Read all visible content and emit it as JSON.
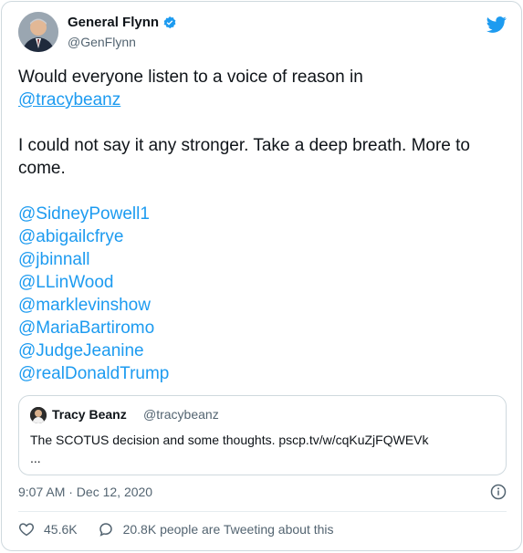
{
  "author": {
    "name": "General Flynn",
    "handle": "@GenFlynn"
  },
  "tweet": {
    "line1": "Would everyone listen to a voice of reason in",
    "mention_primary": "@tracybeanz",
    "paragraph2": "I could not say it any stronger. Take a deep breath. More to come.",
    "mentions": [
      "@SidneyPowell1",
      "@abigailcfrye",
      "@jbinnall",
      "@LLinWood",
      "@marklevinshow",
      "@MariaBartiromo",
      "@JudgeJeanine",
      "@realDonaldTrump"
    ]
  },
  "quote": {
    "name": "Tracy Beanz",
    "handle": "@tracybeanz",
    "text_line1": "The SCOTUS decision and some thoughts. pscp.tv/w/cqKuZjFQWEVk",
    "text_line2": "..."
  },
  "meta": {
    "timestamp": "9:07 AM · Dec 12, 2020"
  },
  "actions": {
    "likes": "45.6K",
    "tweeting": "20.8K people are Tweeting about this"
  },
  "colors": {
    "accent": "#1d9bf0",
    "text": "#0f1419",
    "muted": "#536471"
  },
  "icons": {
    "verified": "verified-badge-icon",
    "logo": "twitter-bird-icon",
    "info": "info-icon",
    "like": "heart-icon",
    "reply": "speech-bubble-icon"
  }
}
